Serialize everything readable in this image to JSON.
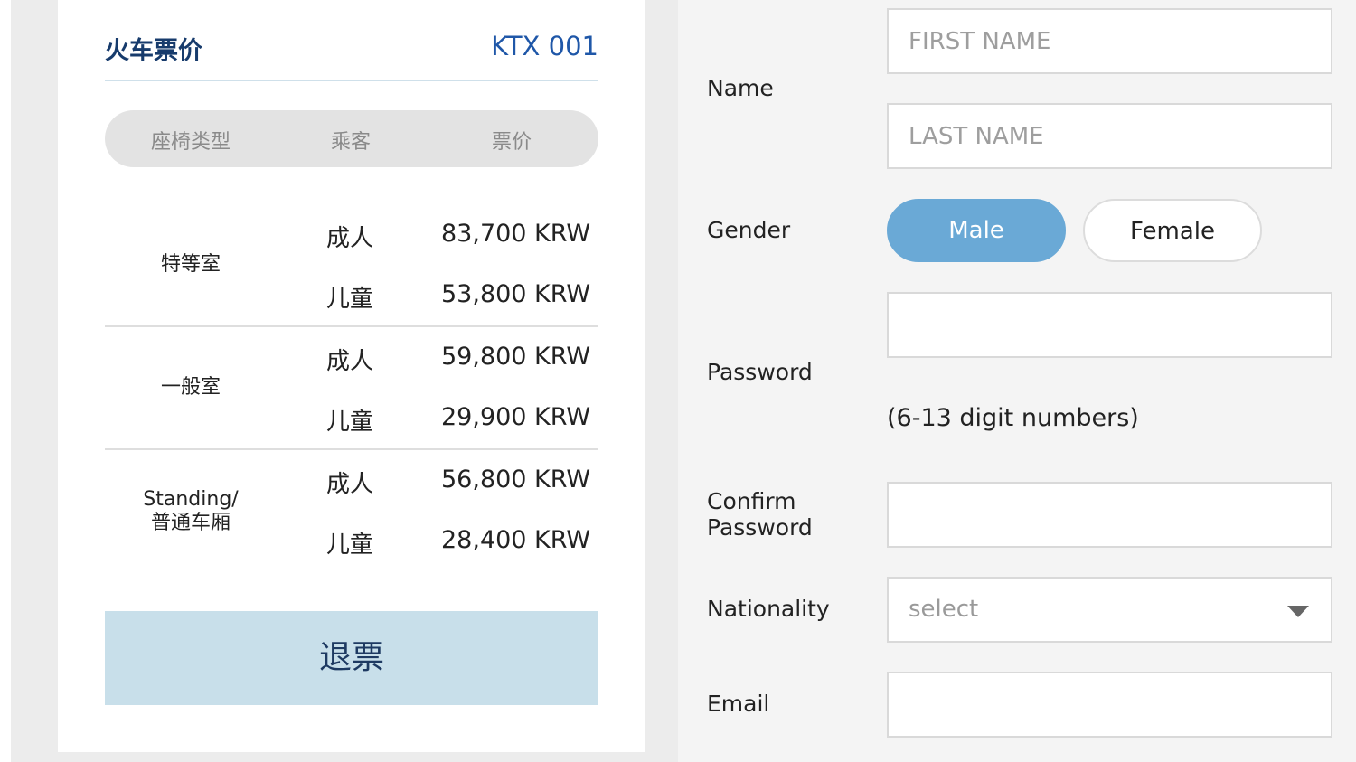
{
  "fare_card": {
    "title": "火车票价",
    "train_number": "KTX 001",
    "columns": [
      "座椅类型",
      "乘客",
      "票价"
    ],
    "rows": [
      {
        "class": "特等室",
        "fares": [
          {
            "passenger": "成人",
            "price": "83,700 KRW"
          },
          {
            "passenger": "儿童",
            "price": "53,800 KRW"
          }
        ]
      },
      {
        "class": "一般室",
        "fares": [
          {
            "passenger": "成人",
            "price": "59,800 KRW"
          },
          {
            "passenger": "儿童",
            "price": "29,900 KRW"
          }
        ]
      },
      {
        "class_line1": "Standing/",
        "class_line2": "普通车厢",
        "fares": [
          {
            "passenger": "成人",
            "price": "56,800 KRW"
          },
          {
            "passenger": "儿童",
            "price": "28,400 KRW"
          }
        ]
      }
    ],
    "refund_label": "退票"
  },
  "form": {
    "name_label": "Name",
    "first_name_placeholder": "FIRST NAME",
    "last_name_placeholder": "LAST NAME",
    "gender_label": "Gender",
    "gender_male": "Male",
    "gender_female": "Female",
    "gender_selected": "Male",
    "password_label": "Password",
    "password_hint": "(6-13 digit numbers)",
    "confirm_label_line1": "Confirm",
    "confirm_label_line2": "Password",
    "nationality_label": "Nationality",
    "nationality_value": "select",
    "email_label": "Email"
  },
  "colors": {
    "accent": "#6aa9d6",
    "refund_button": "#c8dfea",
    "title_navy": "#173b6c",
    "train_number_blue": "#1f57a8"
  },
  "icons": {
    "select_arrow": "chevron-down-icon"
  }
}
